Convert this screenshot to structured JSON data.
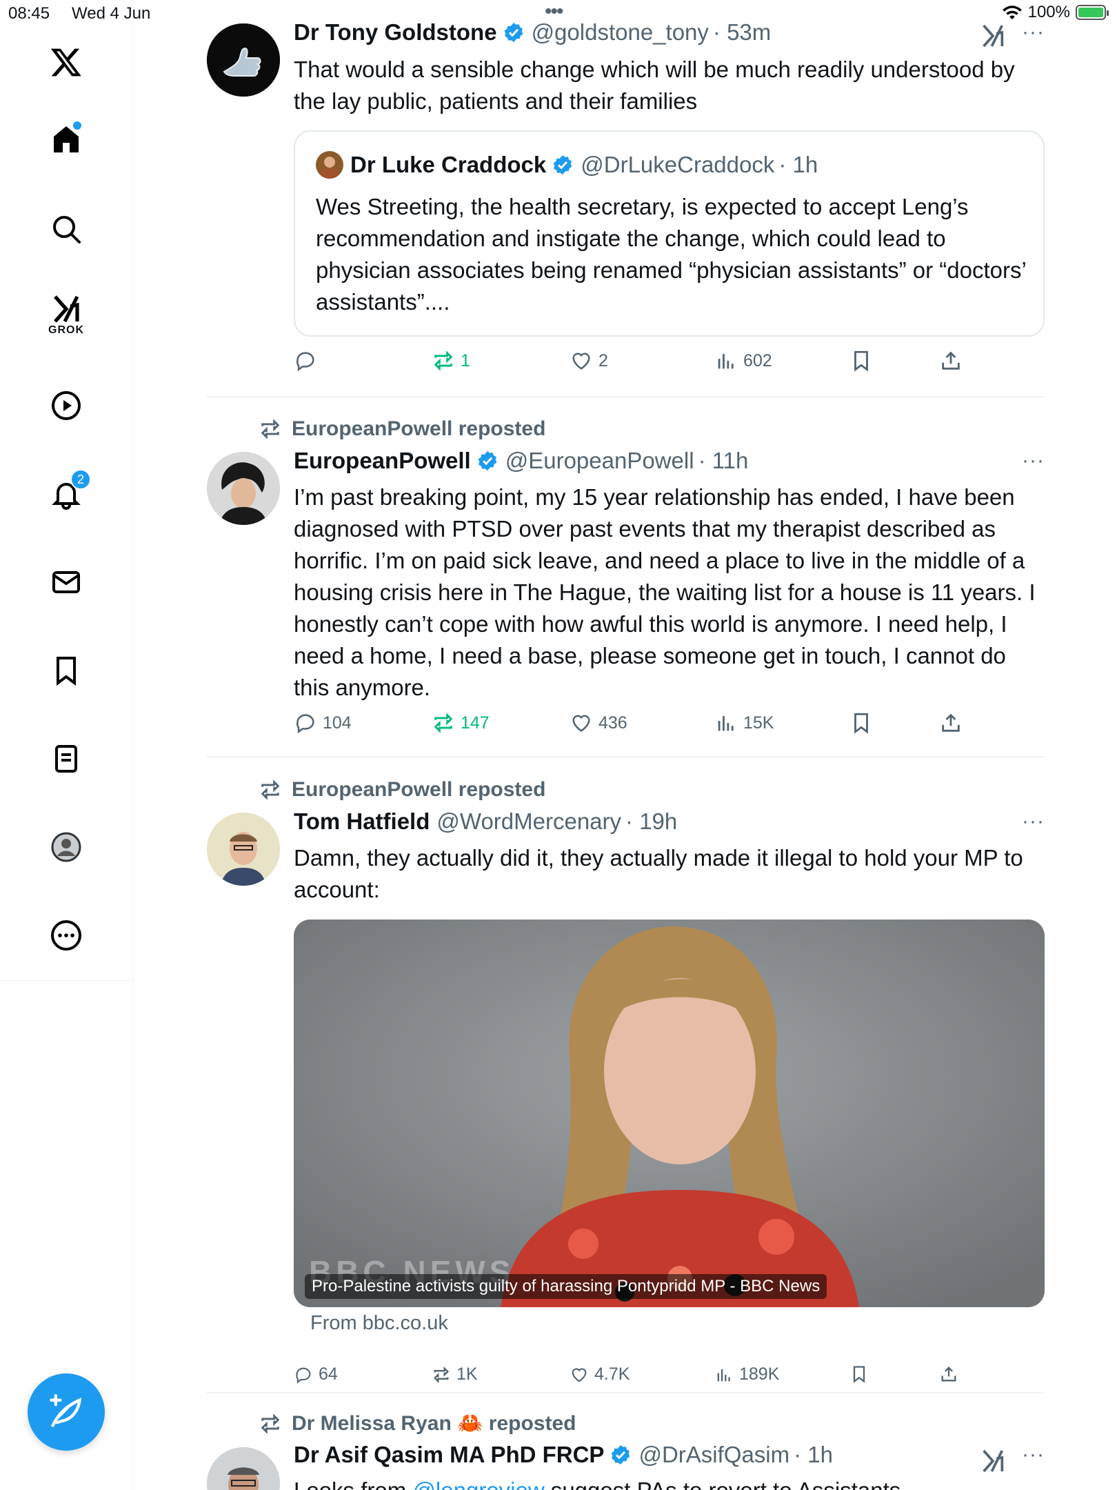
{
  "status": {
    "time": "08:45",
    "date": "Wed 4 Jun",
    "battery": "100%",
    "dots": "•••"
  },
  "sidebar": {
    "grok_label": "GROK",
    "notifications_badge": "2",
    "items": [
      "x-logo",
      "home-icon",
      "search-icon",
      "grok-icon",
      "video-icon",
      "bell-icon",
      "mail-icon",
      "bookmark-icon",
      "list-icon",
      "profile-icon",
      "more-circle-icon"
    ]
  },
  "tweets": [
    {
      "name": "Dr Tony Goldstone",
      "handle": "@goldstone_tony",
      "time": "· 53m",
      "text": "That would a sensible change which will be much readily understood by the lay public, patients and their families",
      "quote": {
        "name": "Dr Luke Craddock",
        "handle": "@DrLukeCraddock",
        "time": "· 1h",
        "text": "Wes Streeting, the health secretary, is expected to accept Leng’s recommendation and instigate the change, which could lead to physician associates being renamed “physician assistants” or “doctors’ assistants”...."
      },
      "stats": {
        "replies": "",
        "reposts": "1",
        "likes": "2",
        "views": "602"
      }
    },
    {
      "repost_label": "EuropeanPowell reposted",
      "name": "EuropeanPowell",
      "handle": "@EuropeanPowell",
      "time": "· 11h",
      "text": "I’m past breaking point, my 15 year relationship has ended, I have been diagnosed with PTSD over past events that my therapist described as horrific. I’m on paid sick leave, and need a place to live in the middle of a housing crisis here in The Hague, the waiting list for a house is 11 years. I honestly can’t cope with how awful this world is anymore. I need help, I need a home, I need a base, please someone get in touch, I cannot do this anymore.",
      "stats": {
        "replies": "104",
        "reposts": "147",
        "likes": "436",
        "views": "15K"
      }
    },
    {
      "repost_label": "EuropeanPowell reposted",
      "name": "Tom Hatfield",
      "handle": "@WordMercenary",
      "time": "· 19h",
      "text": "Damn, they actually did it, they actually made it illegal to hold your MP to account:",
      "media_caption": "Pro-Palestine activists guilty of harassing Pontypridd MP - BBC News",
      "media_watermark": "BBC NEWS",
      "from": "From bbc.co.uk",
      "stats": {
        "replies": "64",
        "reposts": "1K",
        "likes": "4.7K",
        "views": "189K"
      }
    },
    {
      "repost_label": "Dr Melissa Ryan 🦀 reposted",
      "name": "Dr Asif Qasim MA PhD FRCP",
      "handle": "@DrAsifQasim",
      "time": "· 1h",
      "text_prefix": "Looks from ",
      "text_link": "@lengreview",
      "text_suffix": " suggest PAs to revert to Assistants"
    }
  ],
  "more_label": "···",
  "colors": {
    "accent": "#1d9bf0",
    "repost_green": "#00ba7c",
    "muted": "#536471"
  }
}
